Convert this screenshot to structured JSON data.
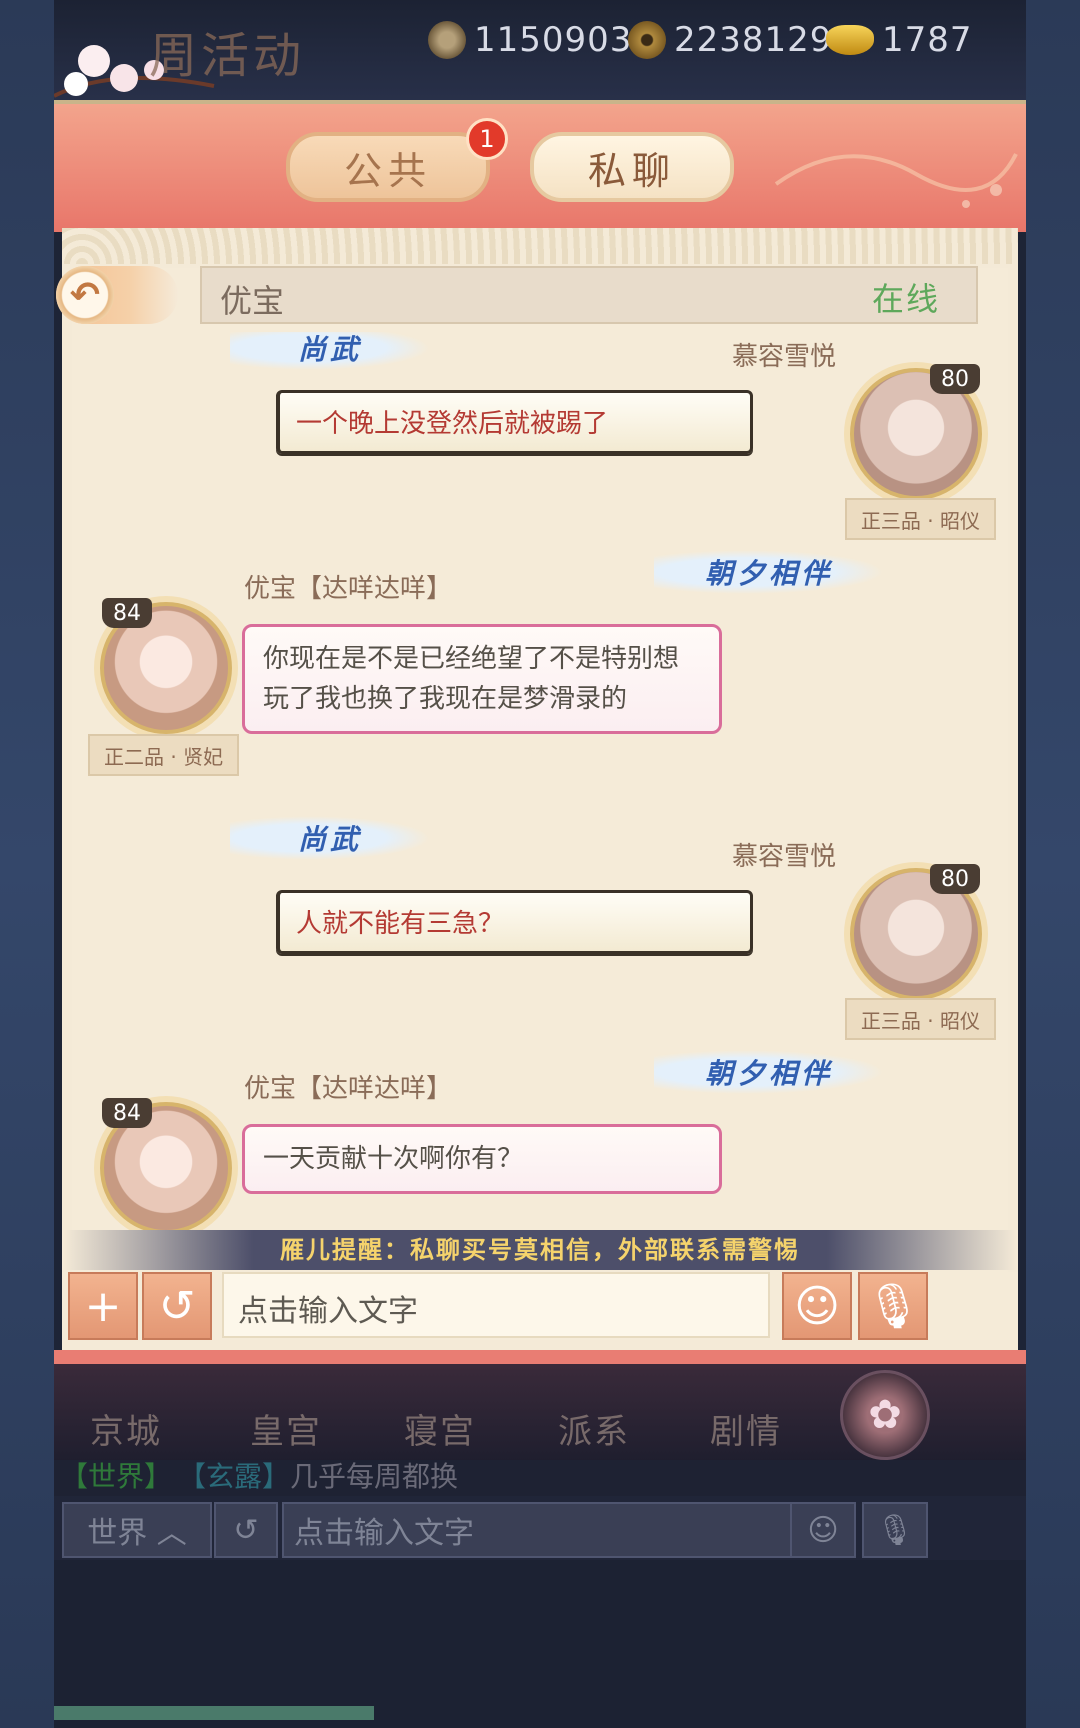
{
  "topbar": {
    "title": "周活动",
    "resources": [
      {
        "icon": "jade-icon",
        "value": "1150903"
      },
      {
        "icon": "coin-icon",
        "value": "2238129"
      },
      {
        "icon": "gold-ingot-icon",
        "value": "1787"
      }
    ]
  },
  "tabs": {
    "public_label": "公共",
    "public_badge": "1",
    "private_label": "私聊"
  },
  "contact": {
    "name": "优宝",
    "status": "在线"
  },
  "messages": [
    {
      "side": "right",
      "sender": "慕容雪悦",
      "text": "一个晚上没登然后就被踢了",
      "level": "80",
      "rank": "正三品 · 昭仪",
      "tag": "尚武"
    },
    {
      "side": "left",
      "sender": "优宝【达咩达咩】",
      "text": "你现在是不是已经绝望了不是特别想玩了我也换了我现在是梦滑录的",
      "level": "84",
      "rank": "正二品 · 贤妃",
      "tag": "朝夕相伴"
    },
    {
      "side": "right",
      "sender": "慕容雪悦",
      "text": "人就不能有三急？",
      "level": "80",
      "rank": "正三品 · 昭仪",
      "tag": "尚武"
    },
    {
      "side": "left",
      "sender": "优宝【达咩达咩】",
      "text": "一天贡献十次啊你有？",
      "level": "84",
      "rank": "",
      "tag": "朝夕相伴"
    }
  ],
  "reminder": "雁儿提醒：私聊买号莫相信，外部联系需警惕",
  "input": {
    "placeholder": "点击输入文字"
  },
  "bottom_nav": [
    "京城",
    "皇宫",
    "寝宫",
    "派系",
    "剧情"
  ],
  "world_chat": {
    "channel1": "【世界】",
    "channel2": "【玄露】",
    "message": "几乎每周都换",
    "channel_button": "世界",
    "placeholder": "点击输入文字"
  },
  "colors": {
    "online": "#5ea85b",
    "reminder": "#f5d36c",
    "bubble_right_text": "#b43a33"
  }
}
